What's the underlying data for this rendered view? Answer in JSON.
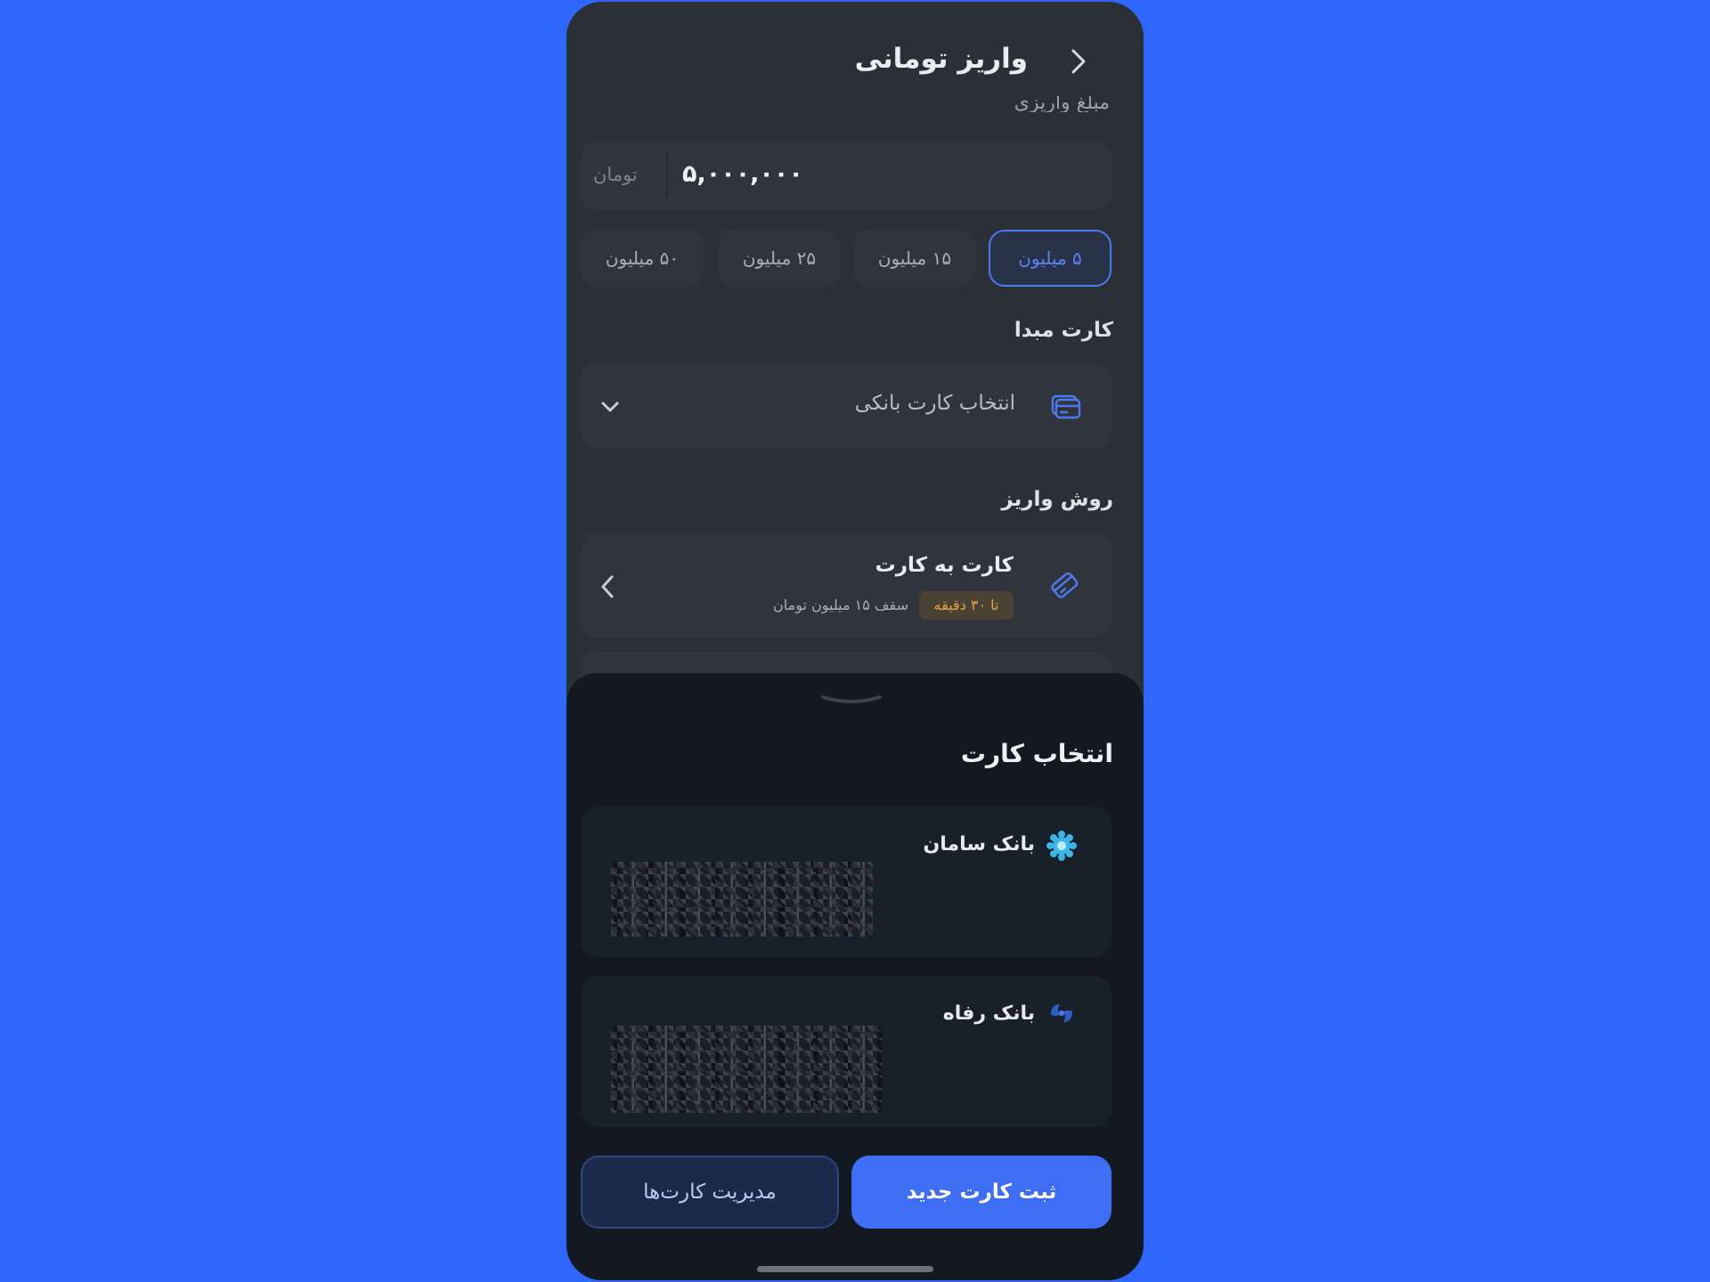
{
  "header": {
    "title": "واریز تومانی"
  },
  "amount": {
    "cut_label": "مبلغ واریزی",
    "value": "۵,۰۰۰,۰۰۰",
    "unit": "تومان"
  },
  "presets": [
    {
      "label": "۵ میلیون",
      "selected": true
    },
    {
      "label": "۱۵ میلیون",
      "selected": false
    },
    {
      "label": "۲۵ میلیون",
      "selected": false
    },
    {
      "label": "۵۰ میلیون",
      "selected": false
    }
  ],
  "source_card": {
    "label": "کارت مبدا",
    "placeholder": "انتخاب کارت بانکی"
  },
  "deposit_method": {
    "label": "روش واریز",
    "option_title": "کارت به کارت",
    "badge": "تا ۳۰ دقیقه",
    "limit": "سقف ۱۵ میلیون تومان"
  },
  "sheet": {
    "title": "انتخاب کارت",
    "banks": [
      {
        "name": "بانک سامان",
        "logo": "saman-bank-logo"
      },
      {
        "name": "بانک رفاه",
        "logo": "refah-bank-logo"
      }
    ],
    "buttons": {
      "primary": "ثبت کارت جدید",
      "secondary": "مدیریت کارت‌ها"
    }
  },
  "colors": {
    "background": "#2f66ff",
    "accent": "#3d6ef5",
    "badge": "#e0a640"
  }
}
